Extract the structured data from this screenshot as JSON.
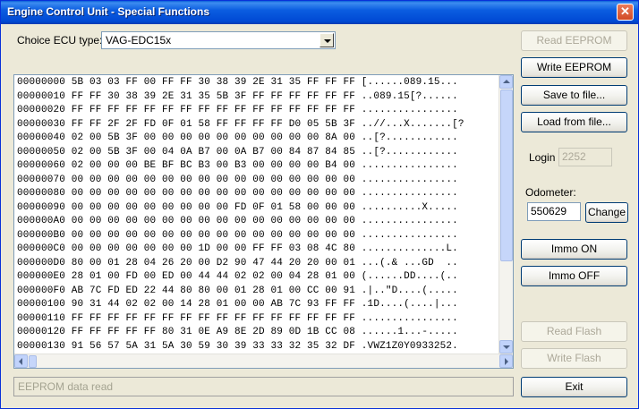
{
  "window": {
    "title": "Engine Control Unit - Special Functions",
    "close_glyph": "✕"
  },
  "ecu": {
    "label": "Choice ECU type:",
    "selected": "VAG-EDC15x"
  },
  "hex_lines": [
    "00000000 5B 03 03 FF 00 FF FF 30 38 39 2E 31 35 FF FF FF [......089.15...",
    "00000010 FF FF 30 38 39 2E 31 35 5B 3F FF FF FF FF FF FF ..089.15[?......",
    "00000020 FF FF FF FF FF FF FF FF FF FF FF FF FF FF FF FF ................",
    "00000030 FF FF 2F 2F FD 0F 01 58 FF FF FF FF D0 05 5B 3F ..//...X.......[?",
    "00000040 02 00 5B 3F 00 00 00 00 00 00 00 00 00 00 8A 00 ..[?............",
    "00000050 02 00 5B 3F 00 04 0A B7 00 0A B7 00 84 87 84 85 ..[?............",
    "00000060 02 00 00 00 BE BF BC B3 00 B3 00 00 00 00 B4 00 ................",
    "00000070 00 00 00 00 00 00 00 00 00 00 00 00 00 00 00 00 ................",
    "00000080 00 00 00 00 00 00 00 00 00 00 00 00 00 00 00 00 ................",
    "00000090 00 00 00 00 00 00 00 00 00 FD 0F 01 58 00 00 00 ..........X.....",
    "000000A0 00 00 00 00 00 00 00 00 00 00 00 00 00 00 00 00 ................",
    "000000B0 00 00 00 00 00 00 00 00 00 00 00 00 00 00 00 00 ................",
    "000000C0 00 00 00 00 00 00 00 1D 00 00 FF FF 03 08 4C 80 ..............L.",
    "000000D0 80 00 01 28 04 26 20 00 D2 90 47 44 20 20 00 01 ...(.& ...GD  ..",
    "000000E0 28 01 00 FD 00 ED 00 44 44 02 02 00 04 28 01 00 (......DD....(..",
    "000000F0 AB 7C FD ED 22 44 80 80 00 01 28 01 00 CC 00 91 .|..\"D....(.....",
    "00000100 90 31 44 02 02 00 14 28 01 00 00 AB 7C 93 FF FF .1D....(....|...",
    "00000110 FF FF FF FF FF FF FF FF FF FF FF FF FF FF FF FF ................",
    "00000120 FF FF FF FF FF 80 31 0E A9 8E 2D 89 0D 1B CC 08 ......1...-.....",
    "00000130 91 56 57 5A 31 5A 30 59 30 39 33 33 32 35 32 DF .VWZ1Z0Y0933252."
  ],
  "buttons": {
    "read_eeprom": "Read EEPROM",
    "write_eeprom": "Write EEPROM",
    "save_file": "Save to file...",
    "load_file": "Load from file...",
    "change": "Change",
    "immo_on": "Immo ON",
    "immo_off": "Immo OFF",
    "read_flash": "Read Flash",
    "write_flash": "Write Flash",
    "exit": "Exit"
  },
  "login": {
    "label": "Login",
    "value": "2252"
  },
  "odometer": {
    "label": "Odometer:",
    "value": "550629"
  },
  "status_text": "EEPROM data read"
}
